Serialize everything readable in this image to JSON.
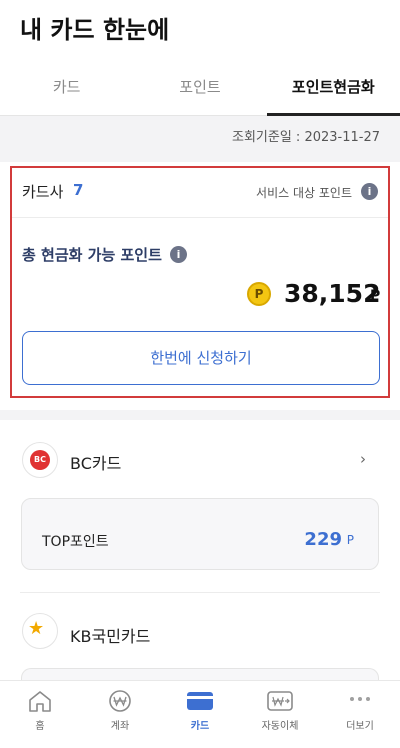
{
  "header": {
    "title": "내 카드 한눈에"
  },
  "tabs": [
    {
      "label": "카드",
      "active": false
    },
    {
      "label": "포인트",
      "active": false
    },
    {
      "label": "포인트현금화",
      "active": true
    }
  ],
  "inquiry_date": "조회기준일 : 2023-11-27",
  "summary": {
    "card_company_label": "카드사",
    "card_company_count": "7",
    "service_points_label": "서비스 대상 포인트",
    "total_label": "총 현금화 가능 포인트",
    "coin_symbol": "P",
    "total_points": "38,152",
    "points_unit": "P",
    "apply_button": "한번에 신청하기"
  },
  "banks": [
    {
      "name": "BC카드",
      "logo_text": "BC",
      "points": [
        {
          "name": "TOP포인트",
          "value": "229",
          "unit": "P"
        }
      ]
    },
    {
      "name": "KB국민카드",
      "logo_text": "★",
      "points": []
    }
  ],
  "bottom_nav": [
    {
      "label": "홈",
      "icon": "home-icon",
      "active": false
    },
    {
      "label": "계좌",
      "icon": "won-circle-icon",
      "active": false
    },
    {
      "label": "카드",
      "icon": "card-icon",
      "active": true
    },
    {
      "label": "자동이체",
      "icon": "auto-transfer-icon",
      "active": false
    },
    {
      "label": "더보기",
      "icon": "more-icon",
      "active": false
    }
  ],
  "colors": {
    "accent": "#3d6fd1",
    "highlight_border": "#d23b3b",
    "coin": "#f3c612"
  }
}
